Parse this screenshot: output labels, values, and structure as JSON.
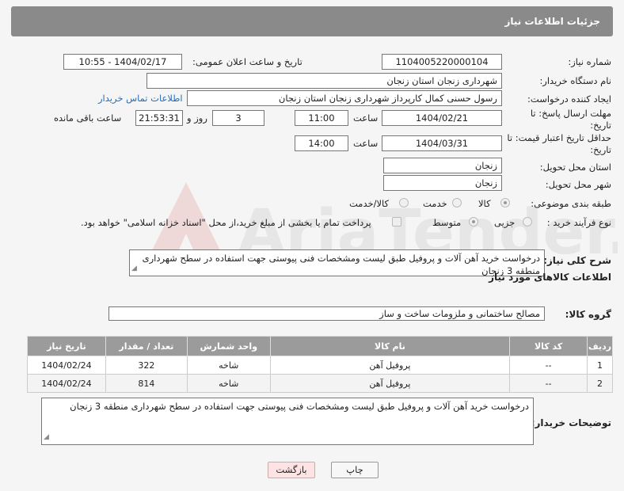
{
  "header": {
    "title": "جزئیات اطلاعات نیاز"
  },
  "fields": {
    "need_number_label": "شماره نیاز:",
    "need_number": "1104005220000104",
    "announce_label": "تاریخ و ساعت اعلان عمومی:",
    "announce_value": "1404/02/17 - 10:55",
    "buyer_label": "نام دستگاه خریدار:",
    "buyer_value": "شهرداری زنجان استان زنجان",
    "creator_label": "ایجاد کننده درخواست:",
    "creator_value": "رسول حسنی کمال کارپرداز شهرداری زنجان استان زنجان",
    "contact_link": "اطلاعات تماس خریدار",
    "deadline_label": "مهلت ارسال پاسخ: تا تاریخ:",
    "deadline_date": "1404/02/21",
    "time_label": "ساعت",
    "deadline_time": "11:00",
    "days_value": "3",
    "days_label": "روز و",
    "remaining_time": "21:53:31",
    "remaining_label": "ساعت باقی مانده",
    "validity_label": "حداقل تاریخ اعتبار قیمت: تا تاریخ:",
    "validity_date": "1404/03/31",
    "validity_time": "14:00",
    "province_label": "استان محل تحویل:",
    "province_value": "زنجان",
    "city_label": "شهر محل تحویل:",
    "city_value": "زنجان",
    "category_label": "طبقه بندی موضوعی:",
    "category_options": [
      "کالا",
      "خدمت",
      "کالا/خدمت"
    ],
    "process_label": "نوع فرآیند خرید :",
    "process_options": [
      "جزیی",
      "متوسط"
    ],
    "payment_note": "پرداخت تمام یا بخشی از مبلغ خرید،از محل \"اسناد خزانه اسلامی\" خواهد بود.",
    "description_label": "شرح کلی نیاز:",
    "description_value": "درخواست خرید آهن آلات و پروفیل طبق لیست ومشخصات فنی پیوستی جهت استفاده در سطح شهرداری منطقه 3 زنجان",
    "goods_info_title": "اطلاعات کالاهای مورد نیاز",
    "goods_group_label": "گروه کالا:",
    "goods_group_value": "مصالح ساختمانی و ملزومات ساخت و ساز",
    "buyer_notes_label": "توضیحات خریدار:",
    "buyer_notes_value": "درخواست خرید آهن آلات و پروفیل طبق لیست ومشخصات فنی پیوستی جهت استفاده در سطح شهرداری منطقه 3 زنجان"
  },
  "table": {
    "headers": [
      "ردیف",
      "کد کالا",
      "نام کالا",
      "واحد شمارش",
      "تعداد / مقدار",
      "تاریخ نیاز"
    ],
    "rows": [
      [
        "1",
        "--",
        "پروفیل آهن",
        "شاخه",
        "322",
        "1404/02/24"
      ],
      [
        "2",
        "--",
        "پروفیل آهن",
        "شاخه",
        "814",
        "1404/02/24"
      ]
    ]
  },
  "buttons": {
    "print": "چاپ",
    "back": "بازگشت"
  },
  "watermark_text": "AriaTender.neT"
}
